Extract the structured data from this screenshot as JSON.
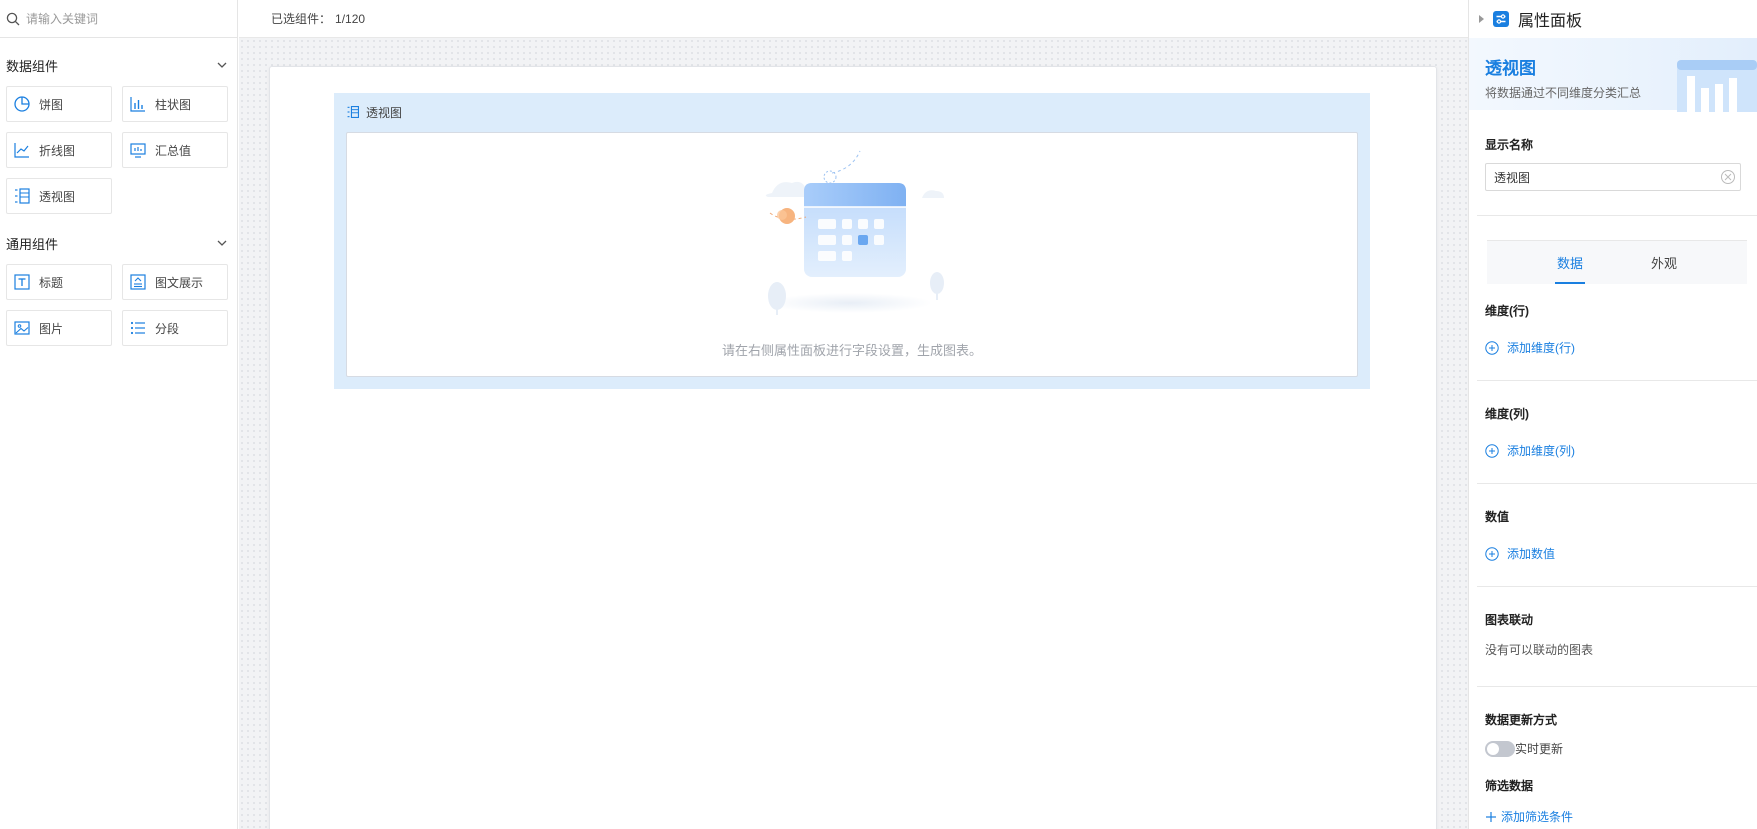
{
  "search": {
    "placeholder": "请输入关键词"
  },
  "sidebar": {
    "groups": [
      {
        "title": "数据组件",
        "items": [
          {
            "label": "饼图",
            "icon": "pie-chart-icon"
          },
          {
            "label": "柱状图",
            "icon": "bar-chart-icon"
          },
          {
            "label": "折线图",
            "icon": "line-chart-icon"
          },
          {
            "label": "汇总值",
            "icon": "summary-icon"
          },
          {
            "label": "透视图",
            "icon": "pivot-icon"
          }
        ]
      },
      {
        "title": "通用组件",
        "items": [
          {
            "label": "标题",
            "icon": "title-icon"
          },
          {
            "label": "图文展示",
            "icon": "image-text-icon"
          },
          {
            "label": "图片",
            "icon": "image-icon"
          },
          {
            "label": "分段",
            "icon": "list-icon"
          }
        ]
      }
    ]
  },
  "topbar": {
    "selected_label": "已选组件：",
    "selected_count": "1/120"
  },
  "widget": {
    "title": "透视图",
    "empty_text": "请在右侧属性面板进行字段设置，生成图表。"
  },
  "panel": {
    "title": "属性面板",
    "banner_title": "透视图",
    "banner_desc": "将数据通过不同维度分类汇总",
    "display_name_label": "显示名称",
    "display_name_value": "透视图",
    "tabs": [
      "数据",
      "外观"
    ],
    "dim_row_label": "维度(行)",
    "dim_row_add": "添加维度(行)",
    "dim_col_label": "维度(列)",
    "dim_col_add": "添加维度(列)",
    "value_label": "数值",
    "value_add": "添加数值",
    "link_label": "图表联动",
    "link_text": "没有可以联动的图表",
    "update_label": "数据更新方式",
    "update_toggle_text": "实时更新",
    "filter_label": "筛选数据",
    "filter_add": "添加筛选条件"
  },
  "colors": {
    "accent": "#1a7fe0",
    "widget_bg": "#dcecfb"
  }
}
